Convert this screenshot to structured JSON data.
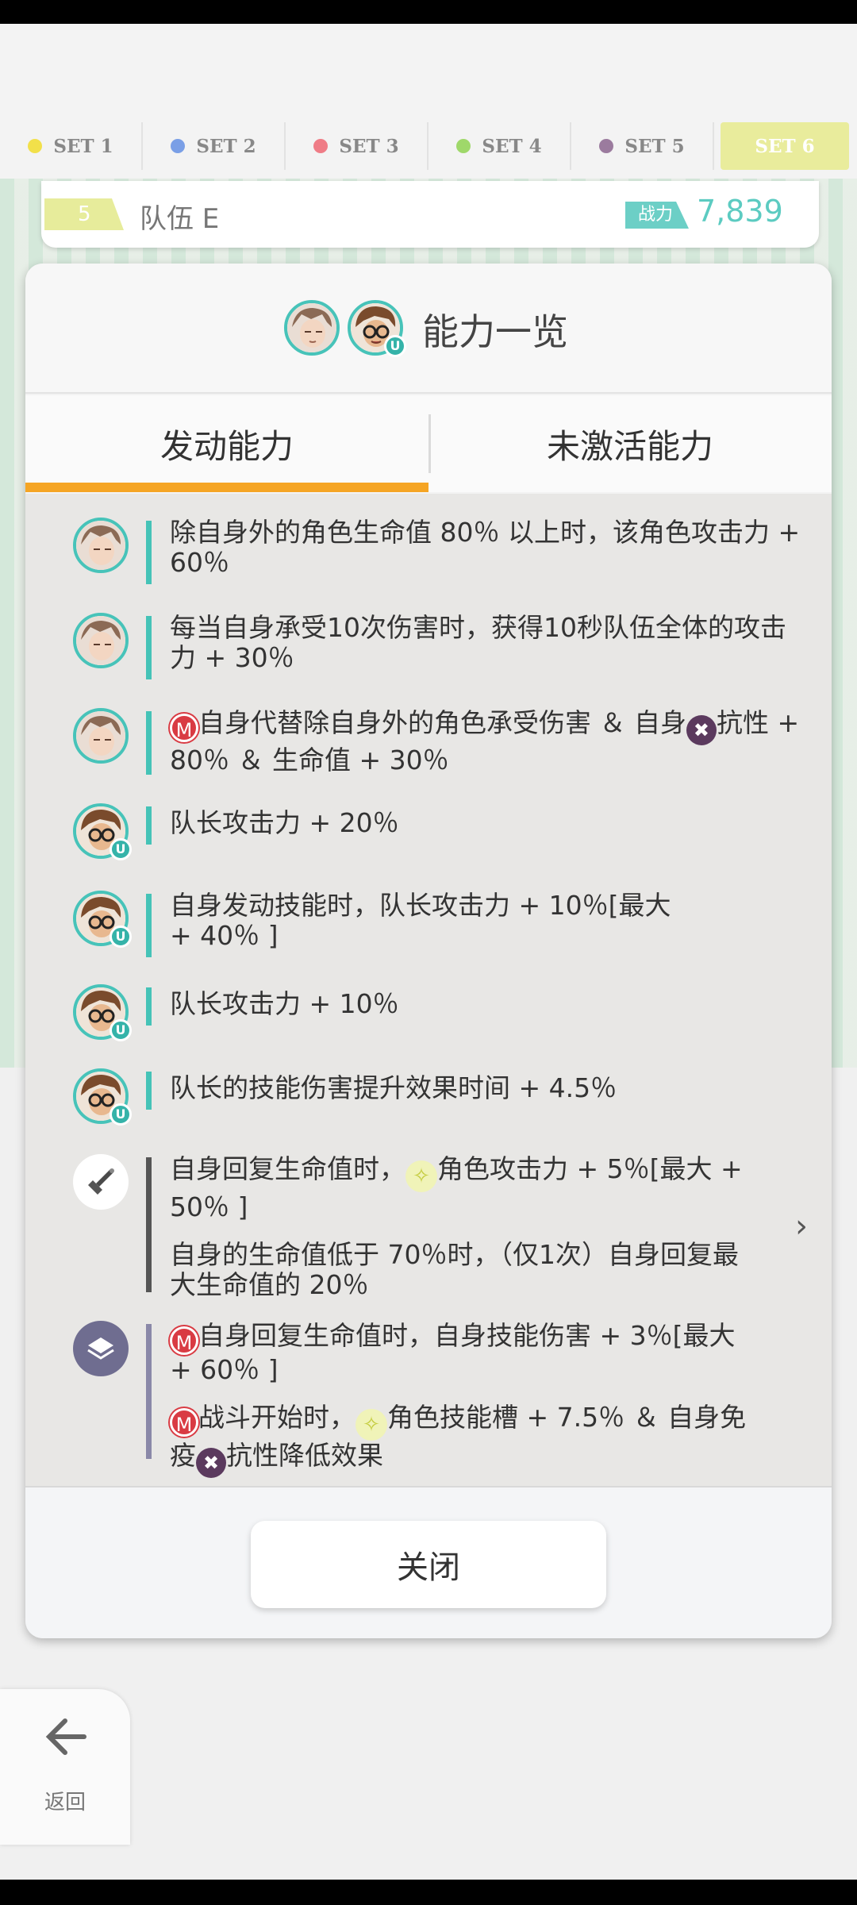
{
  "set_tabs": [
    {
      "label": "SET 1",
      "color": "#f2e04a"
    },
    {
      "label": "SET 2",
      "color": "#7a9fe6"
    },
    {
      "label": "SET 3",
      "color": "#ef7c86"
    },
    {
      "label": "SET 4",
      "color": "#9fd86a"
    },
    {
      "label": "SET 5",
      "color": "#9b7b9e"
    },
    {
      "label": "SET 6",
      "color": "#e9ec9c"
    }
  ],
  "team": {
    "number": "5",
    "name": "队伍 E",
    "power_label": "战力",
    "power_value": "7,839"
  },
  "modal": {
    "title": "能力一览",
    "tabs": [
      {
        "label": "发动能力"
      },
      {
        "label": "未激活能力"
      }
    ],
    "abilities": [
      {
        "icon": "character-a-avatar",
        "bar_color": "#45c3b7",
        "lines": [
          "除自身外的角色生命值 80％ 以上时，该角色攻击力 + 60％"
        ]
      },
      {
        "icon": "character-a-avatar",
        "bar_color": "#45c3b7",
        "lines": [
          "每当自身承受10次伤害时，获得10秒队伍全体的攻击力 + 30％"
        ]
      },
      {
        "icon": "character-a-avatar",
        "bar_color": "#45c3b7",
        "prefix_m": "M",
        "text_a": "自身代替除自身外的角色承受伤害 ＆ 自身",
        "mid_x": "✖",
        "text_b": "抗性 + 80％ ＆ 生命值 + 30％"
      },
      {
        "icon": "character-b-avatar",
        "bar_color": "#45c3b7",
        "lines": [
          "队长攻击力 + 20％"
        ]
      },
      {
        "icon": "character-b-avatar",
        "bar_color": "#45c3b7",
        "lines": [
          "自身发动技能时，队长攻击力 + 10％[最大 + 40％ ]"
        ]
      },
      {
        "icon": "character-b-avatar",
        "bar_color": "#45c3b7",
        "lines": [
          "队长攻击力 + 10％"
        ]
      },
      {
        "icon": "character-b-avatar",
        "bar_color": "#45c3b7",
        "lines": [
          "队长的技能伤害提升效果时间 + 4.5％"
        ]
      },
      {
        "icon": "sword-icon",
        "bar_color": "#555555",
        "text_a": "自身回复生命值时，",
        "mid_star": "✧",
        "text_b": "角色攻击力 + 5％[最大 + 50％ ]",
        "line2": "自身的生命值低于 70％时，（仅1次）自身回复最大生命值的 20％"
      },
      {
        "icon": "shield-icon",
        "bar_color": "#8a88a8",
        "prefix_m": "M",
        "text_a": "自身回复生命值时，自身技能伤害 + 3％[最大 + 60％ ]",
        "prefix_m2": "M",
        "text_c": "战斗开始时，",
        "mid_star": "✧",
        "text_d": "角色技能槽 + 7.5％ ＆ 自身免疫",
        "mid_x": "✖",
        "text_e": "抗性降低效果"
      }
    ],
    "close_label": "关闭"
  },
  "back_label": "返回"
}
